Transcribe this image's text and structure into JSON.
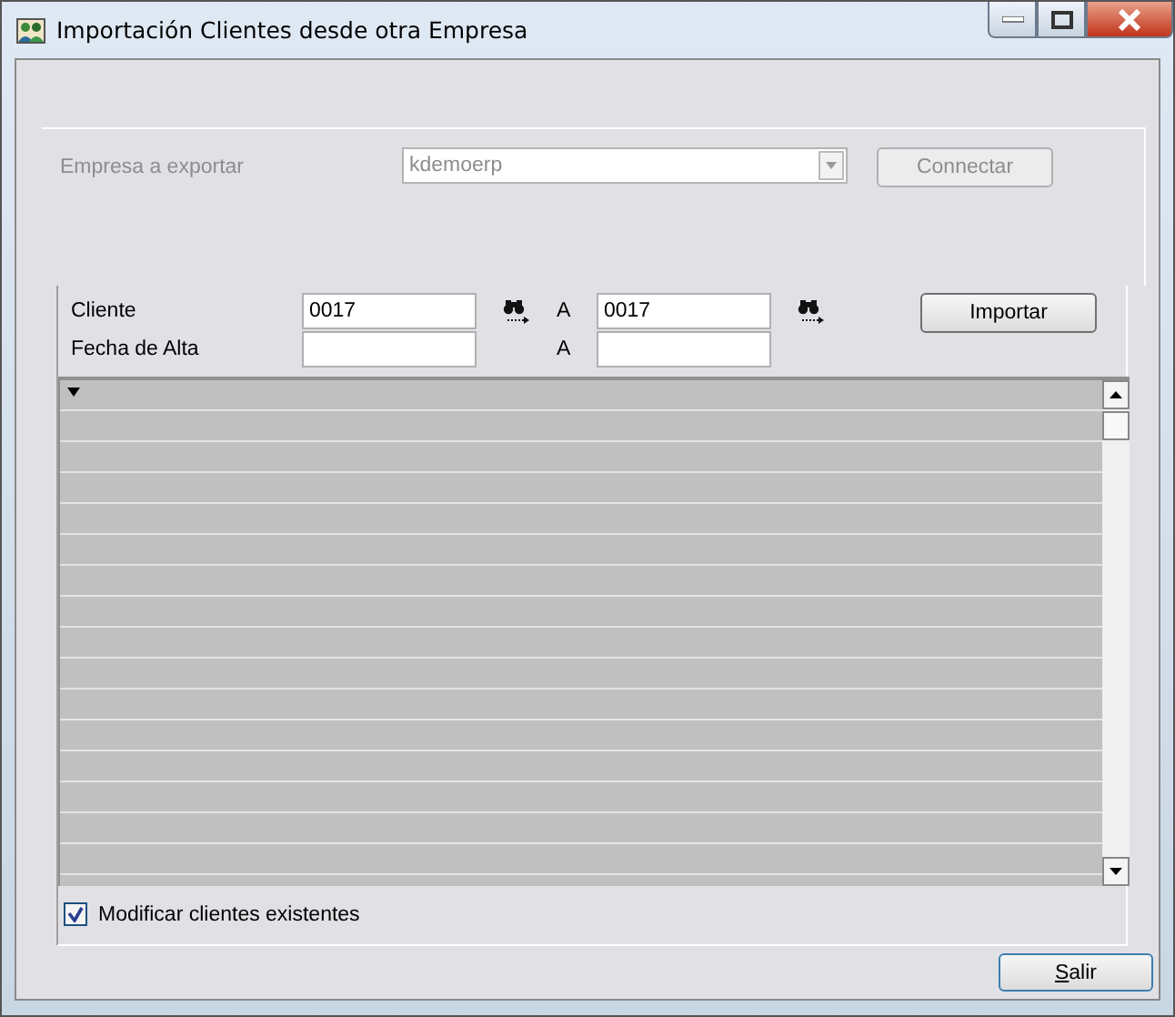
{
  "window": {
    "title": "Importación Clientes desde otra Empresa"
  },
  "company": {
    "label": "Empresa a exportar",
    "value": "kdemoerp",
    "button": "Connectar",
    "disabled": true
  },
  "filters": [
    {
      "label": "Cliente",
      "from": "0017",
      "to_label": "A",
      "to": "0017",
      "lookup": true
    },
    {
      "label": "Fecha de Alta",
      "to_label": "A",
      "lookup": false
    }
  ],
  "import_button": "Importar",
  "checkbox": {
    "label": "Modificar clientes existentes",
    "checked": true
  },
  "exit_button": "Salir"
}
